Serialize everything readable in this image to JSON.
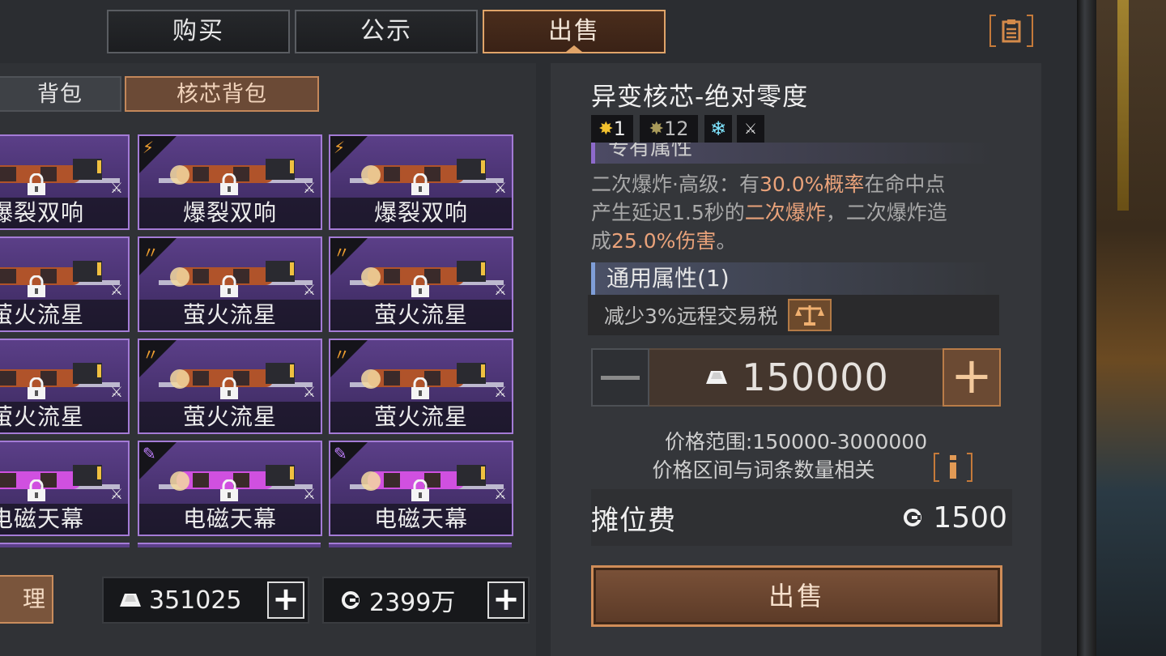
{
  "tabs": [
    {
      "label": "购买"
    },
    {
      "label": "公示"
    },
    {
      "label": "出售"
    }
  ],
  "subtabs": {
    "bag": "背包",
    "core_bag": "核芯背包"
  },
  "items": [
    {
      "name": "爆裂双响",
      "corner": "burst"
    },
    {
      "name": "爆裂双响",
      "corner": "burst"
    },
    {
      "name": "爆裂双响",
      "corner": "burst"
    },
    {
      "name": "萤火流星",
      "corner": "flare"
    },
    {
      "name": "萤火流星",
      "corner": "flare"
    },
    {
      "name": "萤火流星",
      "corner": "flare"
    },
    {
      "name": "萤火流星",
      "corner": "flare"
    },
    {
      "name": "萤火流星",
      "corner": "flare"
    },
    {
      "name": "萤火流星",
      "corner": "flare"
    },
    {
      "name": "电磁天幕",
      "corner": "electric"
    },
    {
      "name": "电磁天幕",
      "corner": "electric"
    },
    {
      "name": "电磁天幕",
      "corner": "electric"
    }
  ],
  "manage_label": "理",
  "wallet": {
    "silver": "351025",
    "gold": "2399万"
  },
  "detail": {
    "title": "异变核芯-绝对零度",
    "badges": {
      "star_gold": "1",
      "star_grey": "12"
    },
    "exclusive_header": "专有属性",
    "desc_parts": [
      "二次爆炸·高级：有",
      "30.0%概率",
      "在命中点产生延迟1.5秒的",
      "二次爆炸",
      "，二次爆炸造成",
      "25.0%伤害",
      "。"
    ],
    "general_header": "通用属性(1)",
    "general_row": "减少3%远程交易税",
    "price": "150000",
    "price_range": "价格范围:150000-3000000",
    "price_note": "价格区间与词条数量相关",
    "fee_label": "摊位费",
    "fee_value": "1500",
    "sell_label": "出售"
  },
  "colors": {
    "accent": "#e0a469",
    "card_border": "#a47bd6",
    "highlight": "#e9a27a"
  }
}
